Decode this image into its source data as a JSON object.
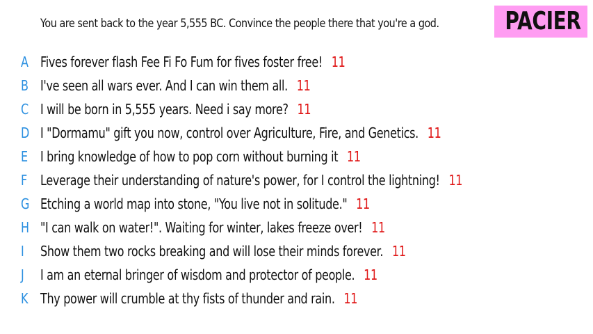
{
  "prompt": "You are sent back to the year 5,555 BC. Convince the people there that you're a god.",
  "badge": "PACIER",
  "answers": [
    {
      "letter": "A",
      "text": "Fives forever flash Fee Fi Fo Fum for fives foster free!",
      "score": "11"
    },
    {
      "letter": "B",
      "text": "I've seen all wars ever. And I can win them all.",
      "score": "11"
    },
    {
      "letter": "C",
      "text": "I will be born in 5,555 years. Need i say more?",
      "score": "11"
    },
    {
      "letter": "D",
      "text": "I \"Dormamu\"  gift you now, control over Agriculture, Fire, and Genetics.",
      "score": "11"
    },
    {
      "letter": "E",
      "text": "I bring knowledge of how to pop corn without burning it",
      "score": "11"
    },
    {
      "letter": "F",
      "text": "Leverage their understanding of nature's power, for I control the lightning!",
      "score": "11"
    },
    {
      "letter": "G",
      "text": "Etching a world map into stone, \"You live not in solitude.\"",
      "score": "11"
    },
    {
      "letter": "H",
      "text": "\"I can walk on water!\". Waiting for winter, lakes freeze over!",
      "score": "11"
    },
    {
      "letter": "I",
      "text": "Show them two rocks breaking and will lose their minds forever.",
      "score": "11"
    },
    {
      "letter": "J",
      "text": "I am an eternal bringer of wisdom and protector of people.",
      "score": "11"
    },
    {
      "letter": "K",
      "text": "Thy power will crumble at thy fists of thunder and rain.",
      "score": "11"
    }
  ],
  "colors": {
    "letter": "#2a8fe0",
    "score": "#e01818",
    "badge_bg": "#ff9cf2"
  }
}
